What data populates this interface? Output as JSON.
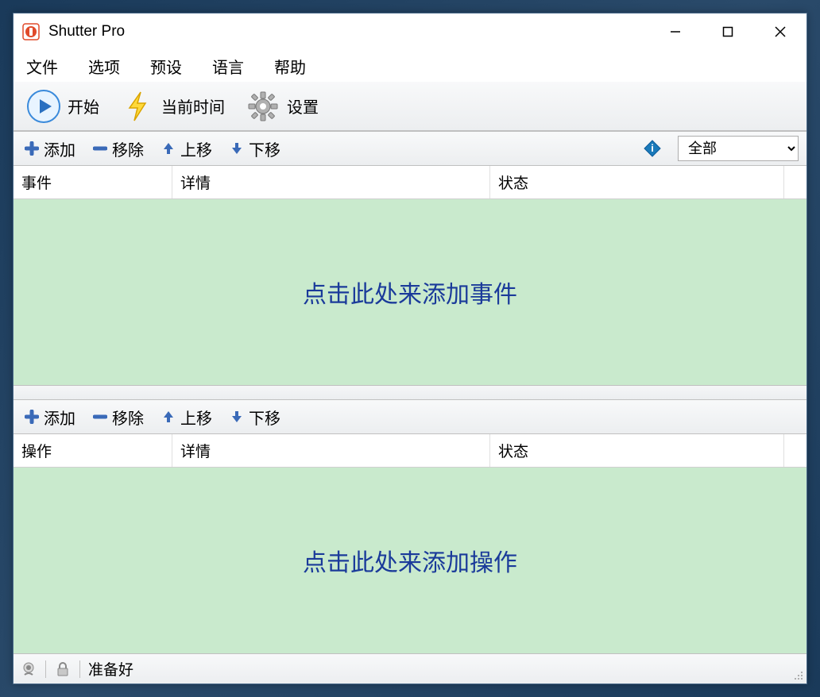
{
  "window": {
    "title": "Shutter Pro"
  },
  "menu": {
    "file": "文件",
    "options": "选项",
    "presets": "预设",
    "language": "语言",
    "help": "帮助"
  },
  "toolbar": {
    "start": "开始",
    "current_time": "当前时间",
    "settings": "设置"
  },
  "list_ops": {
    "add": "添加",
    "remove": "移除",
    "move_up": "上移",
    "move_down": "下移"
  },
  "events": {
    "filter_options": [
      "全部"
    ],
    "filter_selected": "全部",
    "columns": {
      "col1": "事件",
      "col2": "详情",
      "col3": "状态"
    },
    "empty_hint": "点击此处来添加事件"
  },
  "actions": {
    "columns": {
      "col1": "操作",
      "col2": "详情",
      "col3": "状态"
    },
    "empty_hint": "点击此处来添加操作"
  },
  "status": {
    "text": "准备好"
  }
}
